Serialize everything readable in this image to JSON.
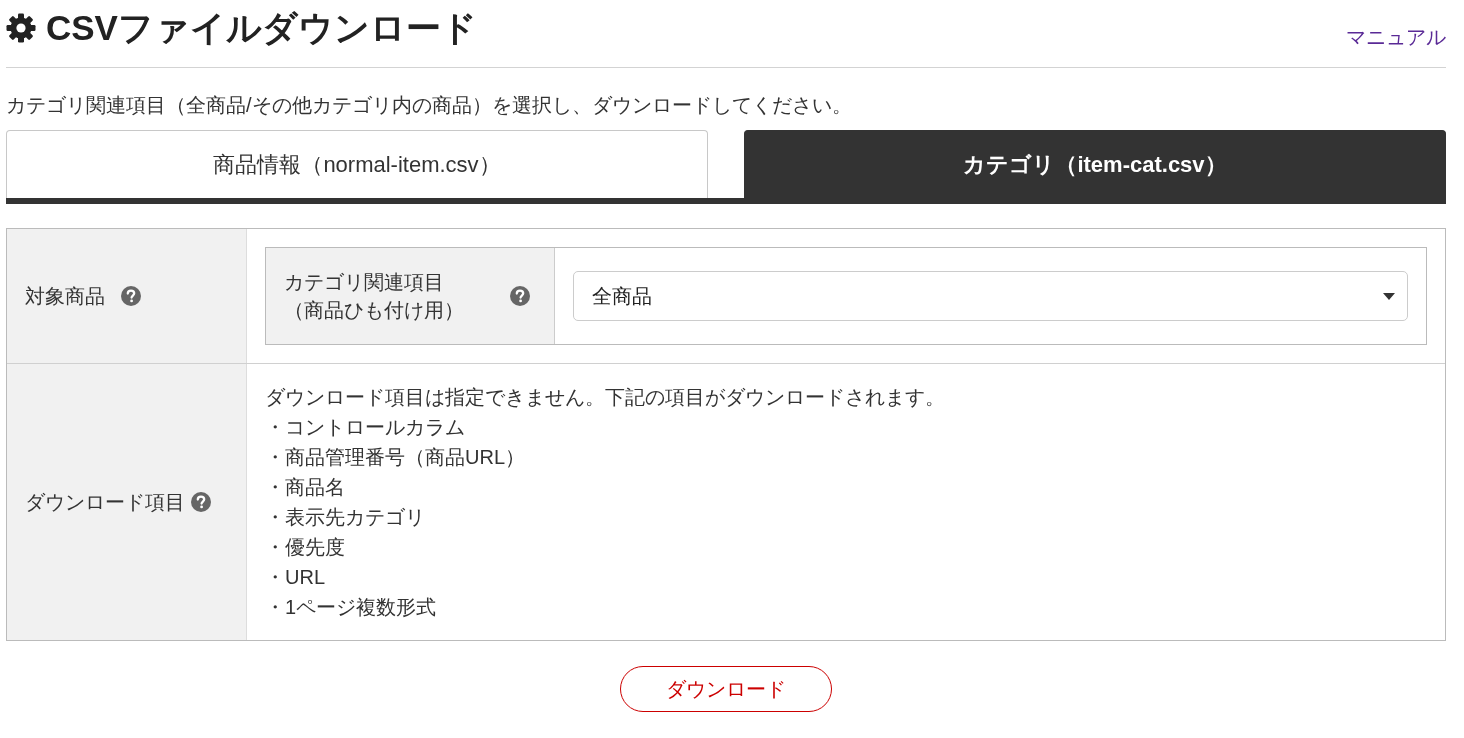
{
  "header": {
    "title": "CSVファイルダウンロード",
    "manual_link": "マニュアル"
  },
  "description": "カテゴリ関連項目（全商品/その他カテゴリ内の商品）を選択し、ダウンロードしてください。",
  "tabs": [
    {
      "label": "商品情報（normal-item.csv）",
      "selected": false
    },
    {
      "label": "カテゴリ（item-cat.csv）",
      "selected": true
    }
  ],
  "form": {
    "rows": [
      {
        "kind": "select",
        "label": "対象商品",
        "field_label_lines": [
          "カテゴリ関連項目",
          "（商品ひも付け用）"
        ],
        "value": "全商品"
      },
      {
        "kind": "list",
        "label": "ダウンロード項目",
        "intro": "ダウンロード項目は指定できません。下記の項目がダウンロードされます。",
        "items": [
          "・コントロールカラム",
          "・商品管理番号（商品URL）",
          "・商品名",
          "・表示先カテゴリ",
          "・優先度",
          "・URL",
          "・1ページ複数形式"
        ]
      }
    ]
  },
  "download_button": "ダウンロード"
}
